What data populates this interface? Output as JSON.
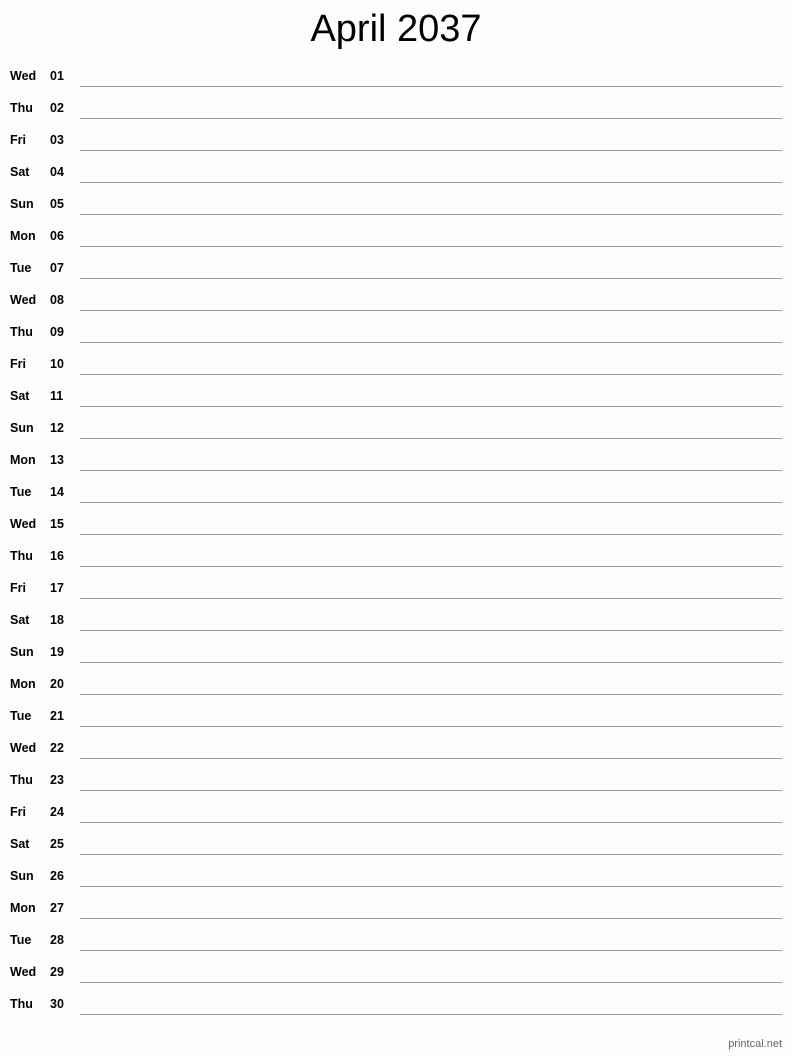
{
  "title": "April 2037",
  "days": [
    {
      "dow": "Wed",
      "num": "01"
    },
    {
      "dow": "Thu",
      "num": "02"
    },
    {
      "dow": "Fri",
      "num": "03"
    },
    {
      "dow": "Sat",
      "num": "04"
    },
    {
      "dow": "Sun",
      "num": "05"
    },
    {
      "dow": "Mon",
      "num": "06"
    },
    {
      "dow": "Tue",
      "num": "07"
    },
    {
      "dow": "Wed",
      "num": "08"
    },
    {
      "dow": "Thu",
      "num": "09"
    },
    {
      "dow": "Fri",
      "num": "10"
    },
    {
      "dow": "Sat",
      "num": "11"
    },
    {
      "dow": "Sun",
      "num": "12"
    },
    {
      "dow": "Mon",
      "num": "13"
    },
    {
      "dow": "Tue",
      "num": "14"
    },
    {
      "dow": "Wed",
      "num": "15"
    },
    {
      "dow": "Thu",
      "num": "16"
    },
    {
      "dow": "Fri",
      "num": "17"
    },
    {
      "dow": "Sat",
      "num": "18"
    },
    {
      "dow": "Sun",
      "num": "19"
    },
    {
      "dow": "Mon",
      "num": "20"
    },
    {
      "dow": "Tue",
      "num": "21"
    },
    {
      "dow": "Wed",
      "num": "22"
    },
    {
      "dow": "Thu",
      "num": "23"
    },
    {
      "dow": "Fri",
      "num": "24"
    },
    {
      "dow": "Sat",
      "num": "25"
    },
    {
      "dow": "Sun",
      "num": "26"
    },
    {
      "dow": "Mon",
      "num": "27"
    },
    {
      "dow": "Tue",
      "num": "28"
    },
    {
      "dow": "Wed",
      "num": "29"
    },
    {
      "dow": "Thu",
      "num": "30"
    }
  ],
  "footer": "printcal.net"
}
